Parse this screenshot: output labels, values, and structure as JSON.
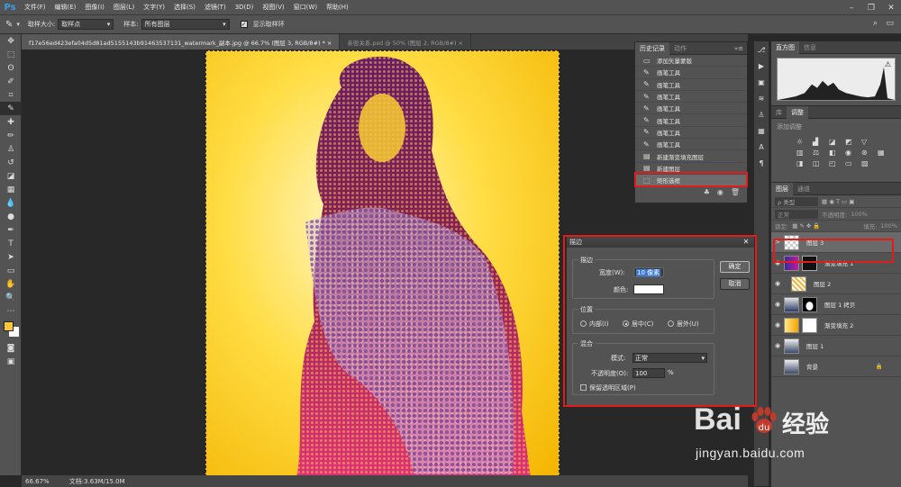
{
  "app": {
    "logo": "Ps"
  },
  "menubar": {
    "items": [
      "文件(F)",
      "编辑(E)",
      "图像(I)",
      "图层(L)",
      "文字(Y)",
      "选择(S)",
      "滤镜(T)",
      "3D(D)",
      "视图(V)",
      "窗口(W)",
      "帮助(H)"
    ]
  },
  "options": {
    "sample_size_label": "取样大小:",
    "sample_size_value": "取样点",
    "sample_label": "样本:",
    "sample_value": "所有图层",
    "show_ring_label": "显示取样环"
  },
  "tabs": [
    {
      "label": "f17e56ed423efa04d5d81ad5155143b91463537131_watermark_副本.jpg @ 66.7% (图层 3, RGB/8#) *  ×"
    },
    {
      "label": "亲密关系.psd @ 50% (图层 2, RGB/8#)  ×"
    }
  ],
  "status": {
    "zoom": "66.67%",
    "doc": "文档:3.63M/15.0M"
  },
  "history": {
    "tabs": [
      "历史记录",
      "动作"
    ],
    "items": [
      "添加矢量蒙版",
      "画笔工具",
      "画笔工具",
      "画笔工具",
      "画笔工具",
      "画笔工具",
      "画笔工具",
      "画笔工具",
      "新建渐变填充图层",
      "新建图层",
      "矩形选框"
    ]
  },
  "right": {
    "histogram_tabs": [
      "直方图",
      "信息"
    ],
    "adjust_tabs": [
      "库",
      "调整"
    ],
    "adjust_add": "添加调整",
    "layers_tabs": [
      "图层",
      "通道"
    ],
    "filter_kind": "ρ 类型",
    "blend": "正常",
    "opacity_label": "不透明度:",
    "opacity_value": "100%",
    "lock_label": "锁定:",
    "fill_label": "填充:",
    "fill_value": "100%",
    "layers": [
      {
        "name": "图层 3"
      },
      {
        "name": "渐变填充 1"
      },
      {
        "name": "图层 2"
      },
      {
        "name": "图层 1 拷贝"
      },
      {
        "name": "渐变填充 2"
      },
      {
        "name": "图层 1"
      },
      {
        "name": "背景"
      }
    ]
  },
  "dialog": {
    "title": "描边",
    "stroke_legend": "描边",
    "width_label": "宽度(W):",
    "width_value": "10 像素",
    "color_label": "颜色:",
    "ok": "确定",
    "cancel": "取消",
    "position_legend": "位置",
    "pos_inside": "内部(I)",
    "pos_center": "居中(C)",
    "pos_outside": "居外(U)",
    "blend_legend": "混合",
    "mode_label": "模式:",
    "mode_value": "正常",
    "opacity_label": "不透明度(O):",
    "opacity_value": "100",
    "opacity_unit": "%",
    "preserve_label": "保留透明区域(P)"
  },
  "watermark": {
    "text1": "Bai",
    "text2": "经验",
    "url": "jingyan.baidu.com"
  },
  "colors": {
    "accent_red": "#e21b1b",
    "fg_swatch": "#ffc73a",
    "bg_swatch": "#ffffff"
  }
}
